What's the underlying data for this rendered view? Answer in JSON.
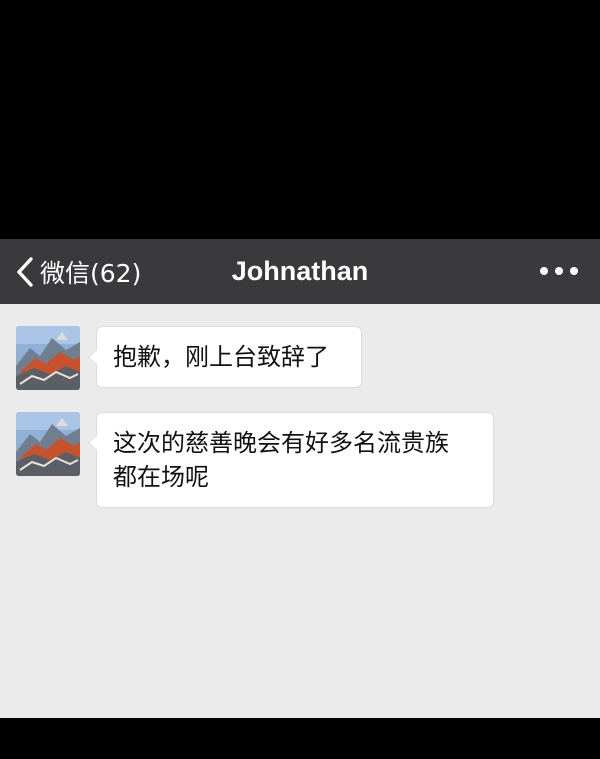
{
  "header": {
    "back_label": "微信(62)",
    "title": "Johnathan",
    "more_icon": "more-dots-icon",
    "back_icon": "chevron-left-icon"
  },
  "colors": {
    "nav_bg": "#3a3a3d",
    "chat_bg": "#ebebeb",
    "bubble_bg": "#ffffff",
    "frame_bg": "#000000"
  },
  "messages": [
    {
      "sender": "Johnathan",
      "text": "抱歉，刚上台致辞了"
    },
    {
      "sender": "Johnathan",
      "text_line1": "这次的慈善晚会有好多名流贵族",
      "text_line2": "都在场呢"
    }
  ]
}
